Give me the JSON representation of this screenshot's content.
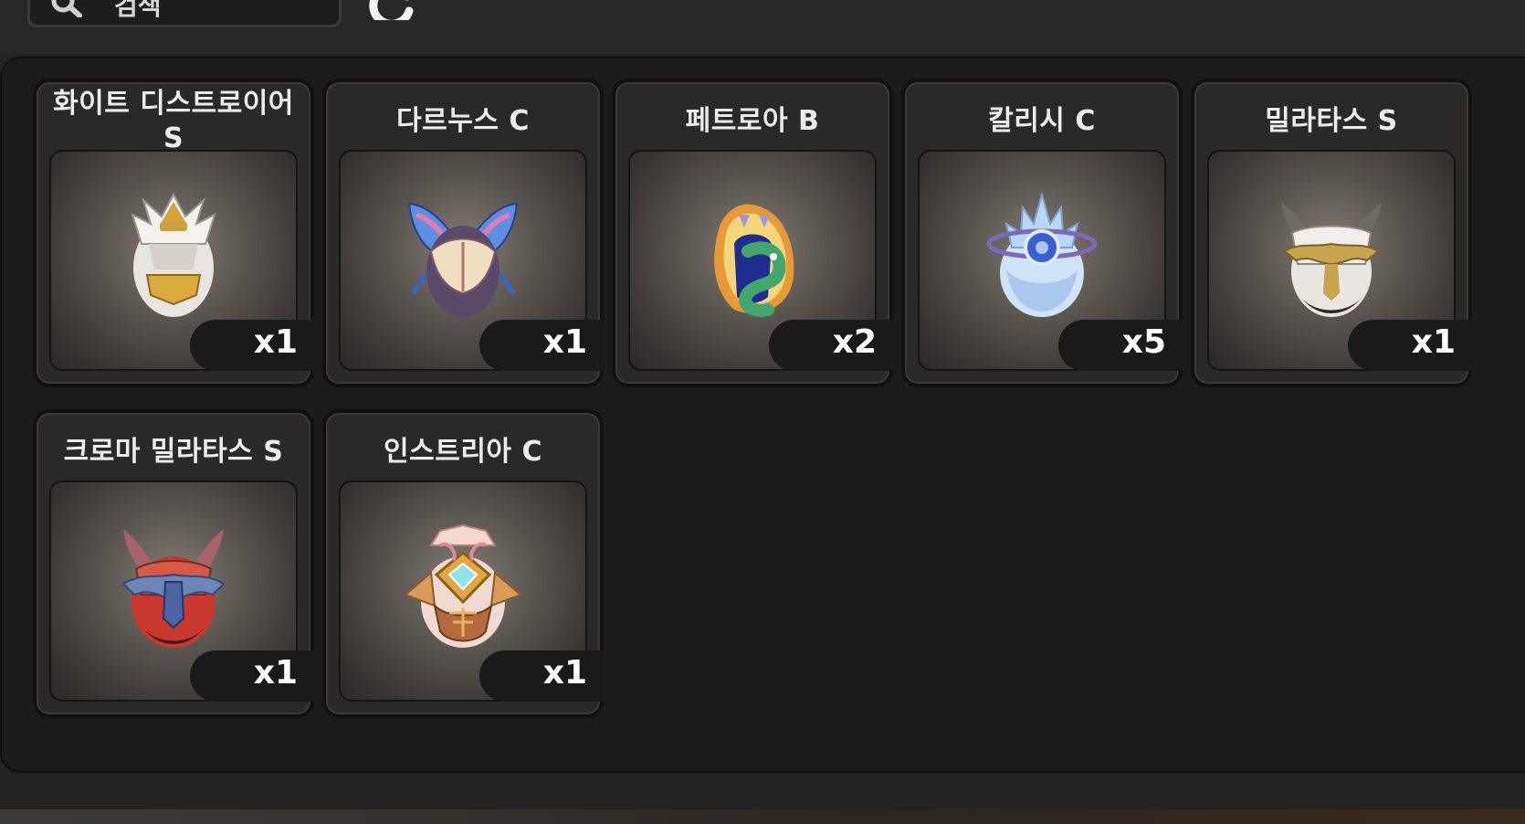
{
  "search": {
    "placeholder": "검색"
  },
  "items": [
    {
      "name": "화이트 디스트로이어 S",
      "count": "x1",
      "egg": "white-destroyer-egg-icon"
    },
    {
      "name": "다르누스 C",
      "count": "x1",
      "egg": "darnus-egg-icon"
    },
    {
      "name": "페트로아 B",
      "count": "x2",
      "egg": "petroa-egg-icon"
    },
    {
      "name": "칼리시 C",
      "count": "x5",
      "egg": "kalisi-egg-icon"
    },
    {
      "name": "밀라타스 S",
      "count": "x1",
      "egg": "milatas-egg-icon"
    },
    {
      "name": "크로마 밀라타스 S",
      "count": "x1",
      "egg": "chroma-milatas-egg-icon"
    },
    {
      "name": "인스트리아 C",
      "count": "x1",
      "egg": "instria-egg-icon"
    }
  ]
}
